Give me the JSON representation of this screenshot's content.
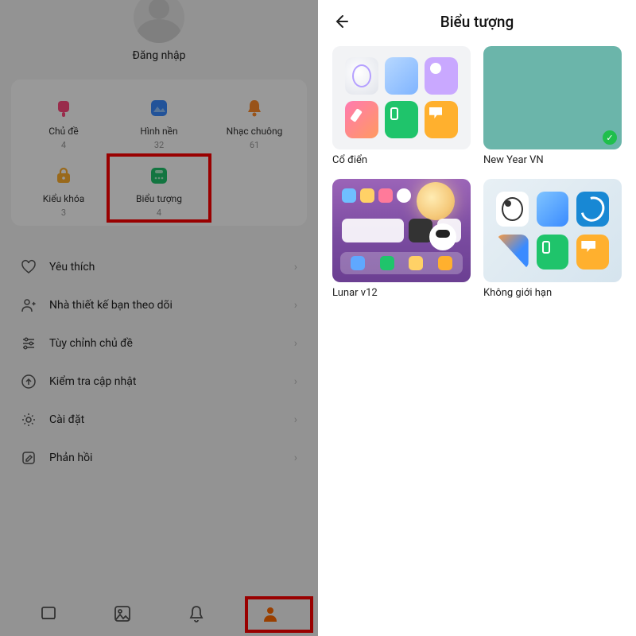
{
  "left": {
    "login": "Đăng nhập",
    "grid": [
      {
        "label": "Chủ đề",
        "count": "4"
      },
      {
        "label": "Hình nền",
        "count": "32"
      },
      {
        "label": "Nhạc chuông",
        "count": "61"
      },
      {
        "label": "Kiểu khóa",
        "count": "3"
      },
      {
        "label": "Biểu tượng",
        "count": "4"
      }
    ],
    "menu": {
      "favorites": "Yêu thích",
      "designers": "Nhà thiết kế bạn theo dõi",
      "customize": "Tùy chỉnh chủ đề",
      "update": "Kiểm tra cập nhật",
      "settings": "Cài đặt",
      "feedback": "Phản hồi"
    }
  },
  "right": {
    "title": "Biểu tượng",
    "packs": [
      {
        "label": "Cổ điển"
      },
      {
        "label": "New Year VN"
      },
      {
        "label": "Lunar v12"
      },
      {
        "label": "Không giới hạn"
      }
    ]
  }
}
